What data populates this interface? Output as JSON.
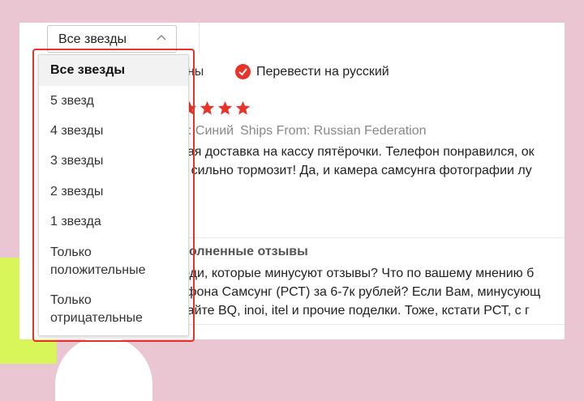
{
  "rating_filter": {
    "selected": "Все звезды",
    "options": [
      {
        "label": "Все звезды",
        "selected": true
      },
      {
        "label": "5 звезд"
      },
      {
        "label": "4 звезды"
      },
      {
        "label": "3 звезды"
      },
      {
        "label": "2 звезды"
      },
      {
        "label": "1 звезда"
      },
      {
        "label": "Только положительные",
        "line1": "Только",
        "line2": "положительные"
      },
      {
        "label": "Только отрицательные",
        "line1": "Только",
        "line2": "отрицательные"
      }
    ]
  },
  "filters": {
    "partial_label": "аны",
    "translate_label": "Перевести на русский",
    "translate_checked": true
  },
  "review1": {
    "stars": 5,
    "color_meta": ": Синий",
    "ships_from": "Ships From: Russian Federation",
    "text_line1": "рая доставка на кассу пятёрочки. Телефон понравился, ок",
    "text_line2": "б сильно тормозит! Да, и камера самсунга фотографии лу"
  },
  "review2": {
    "section_title": "олненные отзывы",
    "text_line1": "юди, которые минусуют отзывы? Что по вашему мнению б",
    "text_line2": "тфона Самсунг (РСТ) за 6-7к рублей? Если Вам, минусующ",
    "text_line3": "пайте BQ, inoi, itel и прочие поделки. Тоже, кстати РСТ, с г"
  },
  "colors": {
    "accent": "#e8332a",
    "background": "#eac6d2",
    "deco_green": "#d8f55a"
  }
}
